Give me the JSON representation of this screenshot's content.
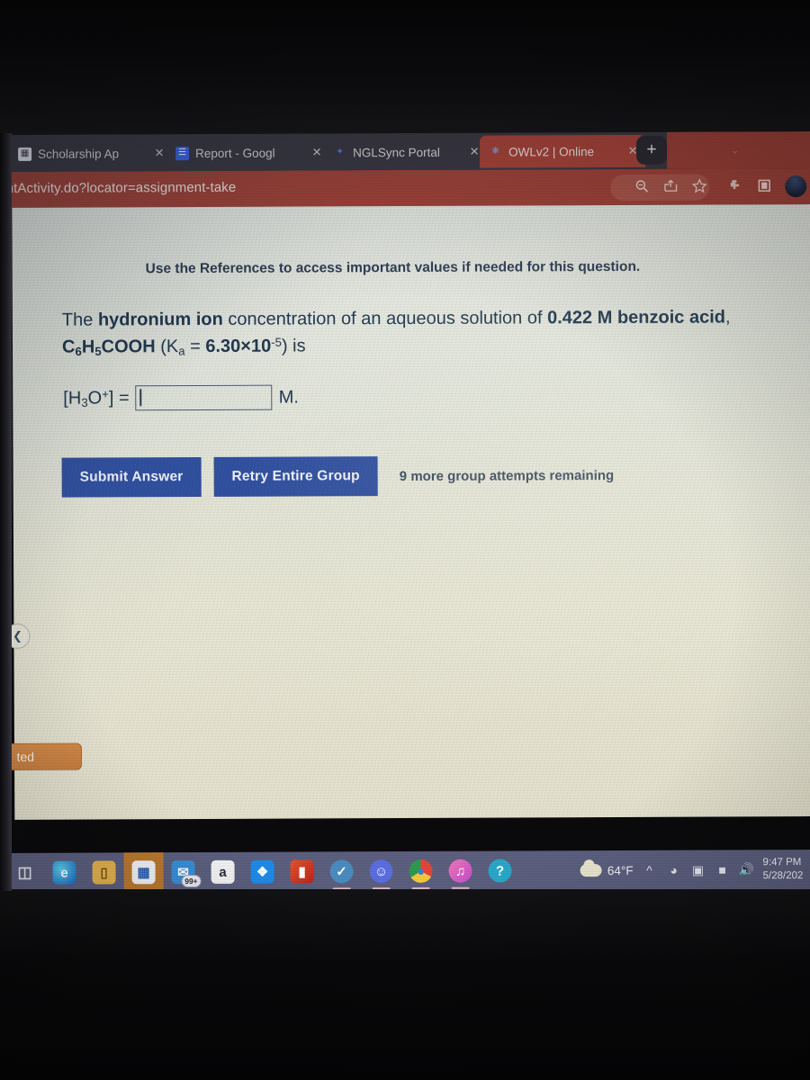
{
  "browser": {
    "tabs": [
      {
        "label": "Scholarship Ap",
        "favicon": "document-icon",
        "favicon_color": "#e9e9ef",
        "active": false,
        "close": "✕"
      },
      {
        "label": "Report - Googl",
        "favicon": "google-docs-icon",
        "favicon_color": "#3b66e8",
        "active": false,
        "close": "✕"
      },
      {
        "label": "NGLSync Portal",
        "favicon": "nglsync-icon",
        "favicon_color": "#2f5fd0",
        "active": false,
        "close": "✕"
      },
      {
        "label": "OWLv2 | Online",
        "favicon": "owl-icon",
        "favicon_color": "#c0493f",
        "active": true,
        "close": "✕"
      }
    ],
    "new_tab_label": "+",
    "tabstrip_chevron": "⌄",
    "url": "entActivity.do?locator=assignment-take",
    "toolbar_icons": [
      "zoom-icon",
      "share-icon",
      "favorite-star-icon",
      "extensions-puzzle-icon",
      "collections-icon",
      "profile-avatar"
    ],
    "accent_active_tab_color": "#a9453c",
    "omnibox_color": "#a0443b"
  },
  "page": {
    "reference_note": "Use the References to access important values if needed for this question.",
    "question": {
      "lead": "The ",
      "bold_subject": "hydronium ion",
      "mid": " concentration of an aqueous solution of ",
      "concentration": "0.422 M",
      "substance": "benzoic acid",
      "formula_prefix": ", C",
      "formula": "C6H5COOH",
      "ka_label": "K",
      "ka_sub": "a",
      "ka_equals": " = ",
      "ka_value": "6.30×10",
      "ka_exponent": "-5",
      "tail": ") is"
    },
    "answer": {
      "label_lead": "[H",
      "label_sub": "3",
      "label_mid": "O",
      "label_sup": "+",
      "label_tail": "] =",
      "value": "",
      "placeholder": "",
      "unit": "M."
    },
    "buttons": {
      "submit_label": "Submit Answer",
      "retry_label": "Retry Entire Group",
      "button_color": "#2f4fa0"
    },
    "attempts_text": "9 more group attempts remaining",
    "left_collapse_icon": "❮",
    "side_tab_label": "ted"
  },
  "taskbar": {
    "start_icon": "task-view-icon",
    "apps": [
      {
        "name": "edge-icon",
        "glyph": "e",
        "color": "#2b7fc4",
        "running": false
      },
      {
        "name": "file-explorer-icon",
        "glyph": "▭",
        "color": "#e8b44b",
        "running": false
      },
      {
        "name": "microsoft-store-icon",
        "glyph": "▣",
        "color": "#f2f2f6",
        "running": false,
        "highlighted": true
      },
      {
        "name": "mail-icon",
        "glyph": "✉",
        "color": "#2f86d8",
        "running": false,
        "badge": "99+"
      },
      {
        "name": "amazon-icon",
        "glyph": "a",
        "color": "#f4f4f4",
        "running": false
      },
      {
        "name": "dropbox-icon",
        "glyph": "❖",
        "color": "#1e8bea",
        "running": false
      },
      {
        "name": "office-icon",
        "glyph": "▮",
        "color": "#d73b22",
        "running": false
      },
      {
        "name": "steam-icon",
        "glyph": "●",
        "color": "#2f6fa8",
        "running": true
      },
      {
        "name": "discord-icon",
        "glyph": "●",
        "color": "#5a6ee0",
        "running": true
      },
      {
        "name": "chrome-icon",
        "glyph": "●",
        "color": "#39a85a",
        "running": true
      },
      {
        "name": "itunes-icon",
        "glyph": "♫",
        "color": "#e05a9c",
        "running": true
      },
      {
        "name": "help-icon",
        "glyph": "?",
        "color": "#2aa7c8",
        "running": false
      }
    ],
    "weather_temp": "64°F",
    "weather_icon": "cloud-icon",
    "tray_icons": [
      "show-hidden-icons-chevron",
      "camera-icon",
      "onedrive-icon",
      "battery-icon",
      "volume-icon"
    ],
    "clock_time": "9:47 PM",
    "clock_date": "5/28/202",
    "taskbar_color": "#5c5f7e"
  }
}
